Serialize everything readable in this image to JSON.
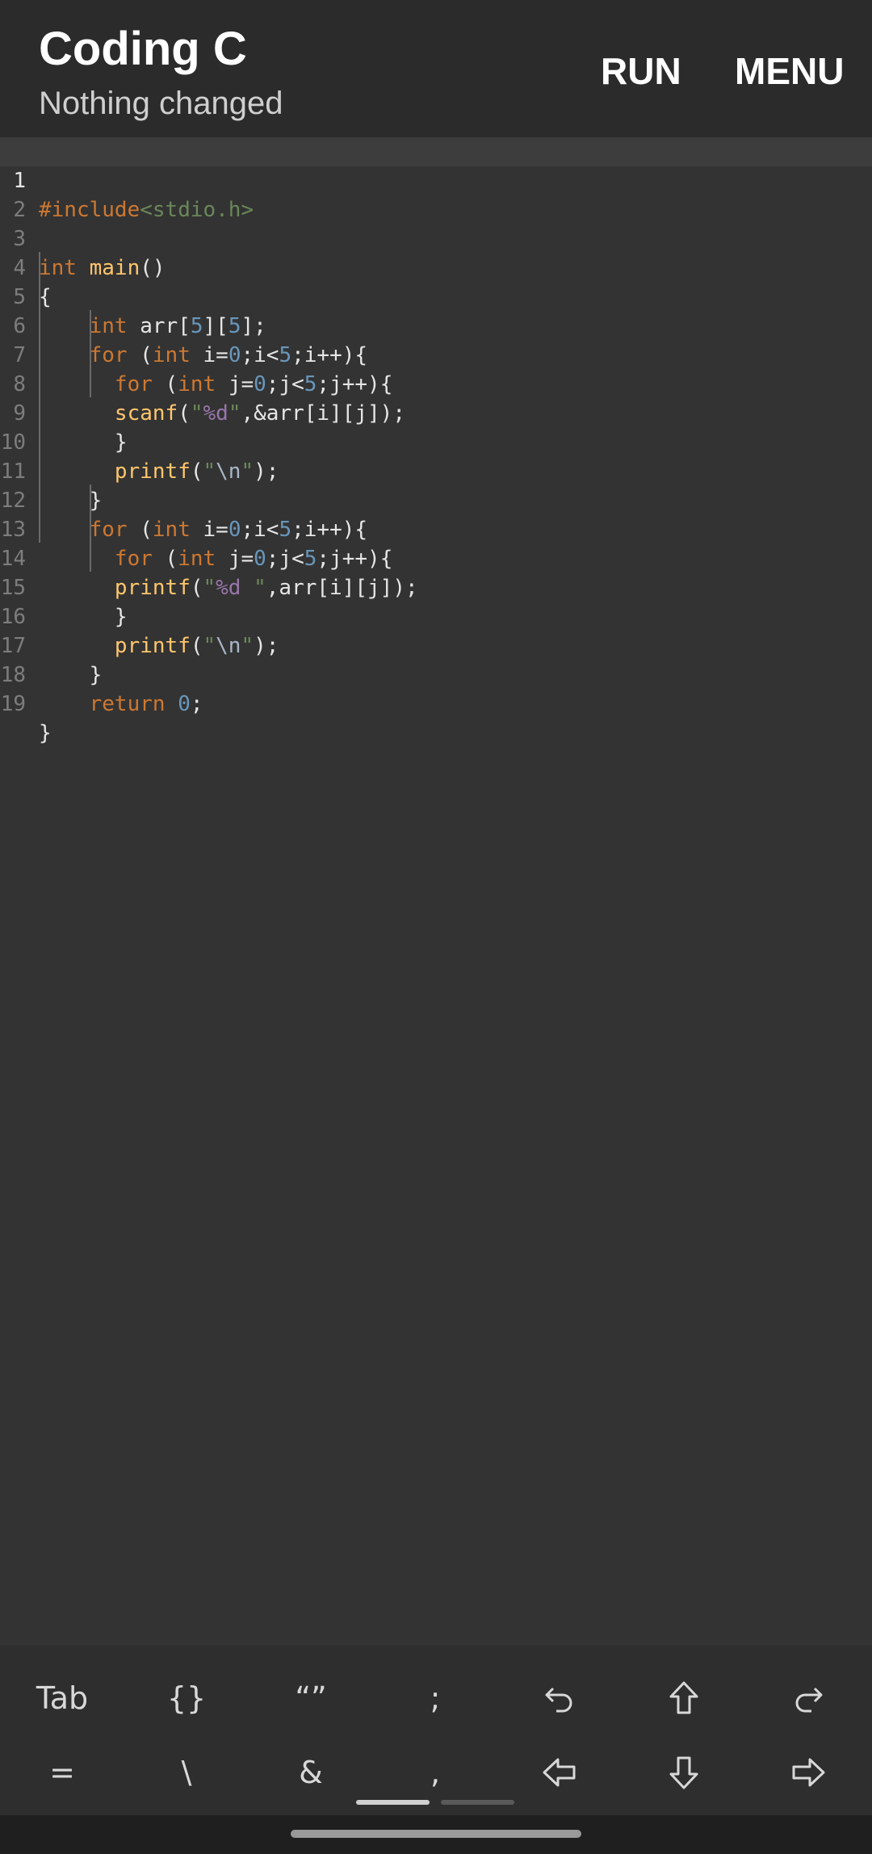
{
  "header": {
    "title": "Coding C",
    "subtitle": "Nothing changed",
    "run_label": "RUN",
    "menu_label": "MENU"
  },
  "editor": {
    "line_numbers": [
      "1",
      "2",
      "3",
      "4",
      "5",
      "6",
      "7",
      "8",
      "9",
      "10",
      "11",
      "12",
      "13",
      "14",
      "15",
      "16",
      "17",
      "18",
      "19"
    ],
    "current_line": 1
  },
  "symbol_bar": {
    "row1": [
      {
        "label": "Tab",
        "name": "tab-key"
      },
      {
        "label": "{}",
        "name": "braces-key"
      },
      {
        "label": "“”",
        "name": "quotes-key"
      },
      {
        "label": ";",
        "name": "semicolon-key"
      },
      {
        "label": "",
        "name": "undo-key",
        "icon": "undo-icon"
      },
      {
        "label": "",
        "name": "cursor-up-key",
        "icon": "arrow-up-icon"
      },
      {
        "label": "",
        "name": "redo-key",
        "icon": "redo-icon"
      }
    ],
    "row2": [
      {
        "label": "=",
        "name": "equals-key"
      },
      {
        "label": "\\",
        "name": "backslash-key"
      },
      {
        "label": "&",
        "name": "ampersand-key"
      },
      {
        "label": ",",
        "name": "comma-key"
      },
      {
        "label": "",
        "name": "cursor-left-key",
        "icon": "arrow-left-icon"
      },
      {
        "label": "",
        "name": "cursor-down-key",
        "icon": "arrow-down-icon"
      },
      {
        "label": "",
        "name": "cursor-right-key",
        "icon": "arrow-right-icon"
      }
    ]
  },
  "colors": {
    "keyword": "#cc7832",
    "function": "#ffc66d",
    "number": "#6897bb",
    "string": "#6a8759",
    "format": "#9876aa"
  }
}
